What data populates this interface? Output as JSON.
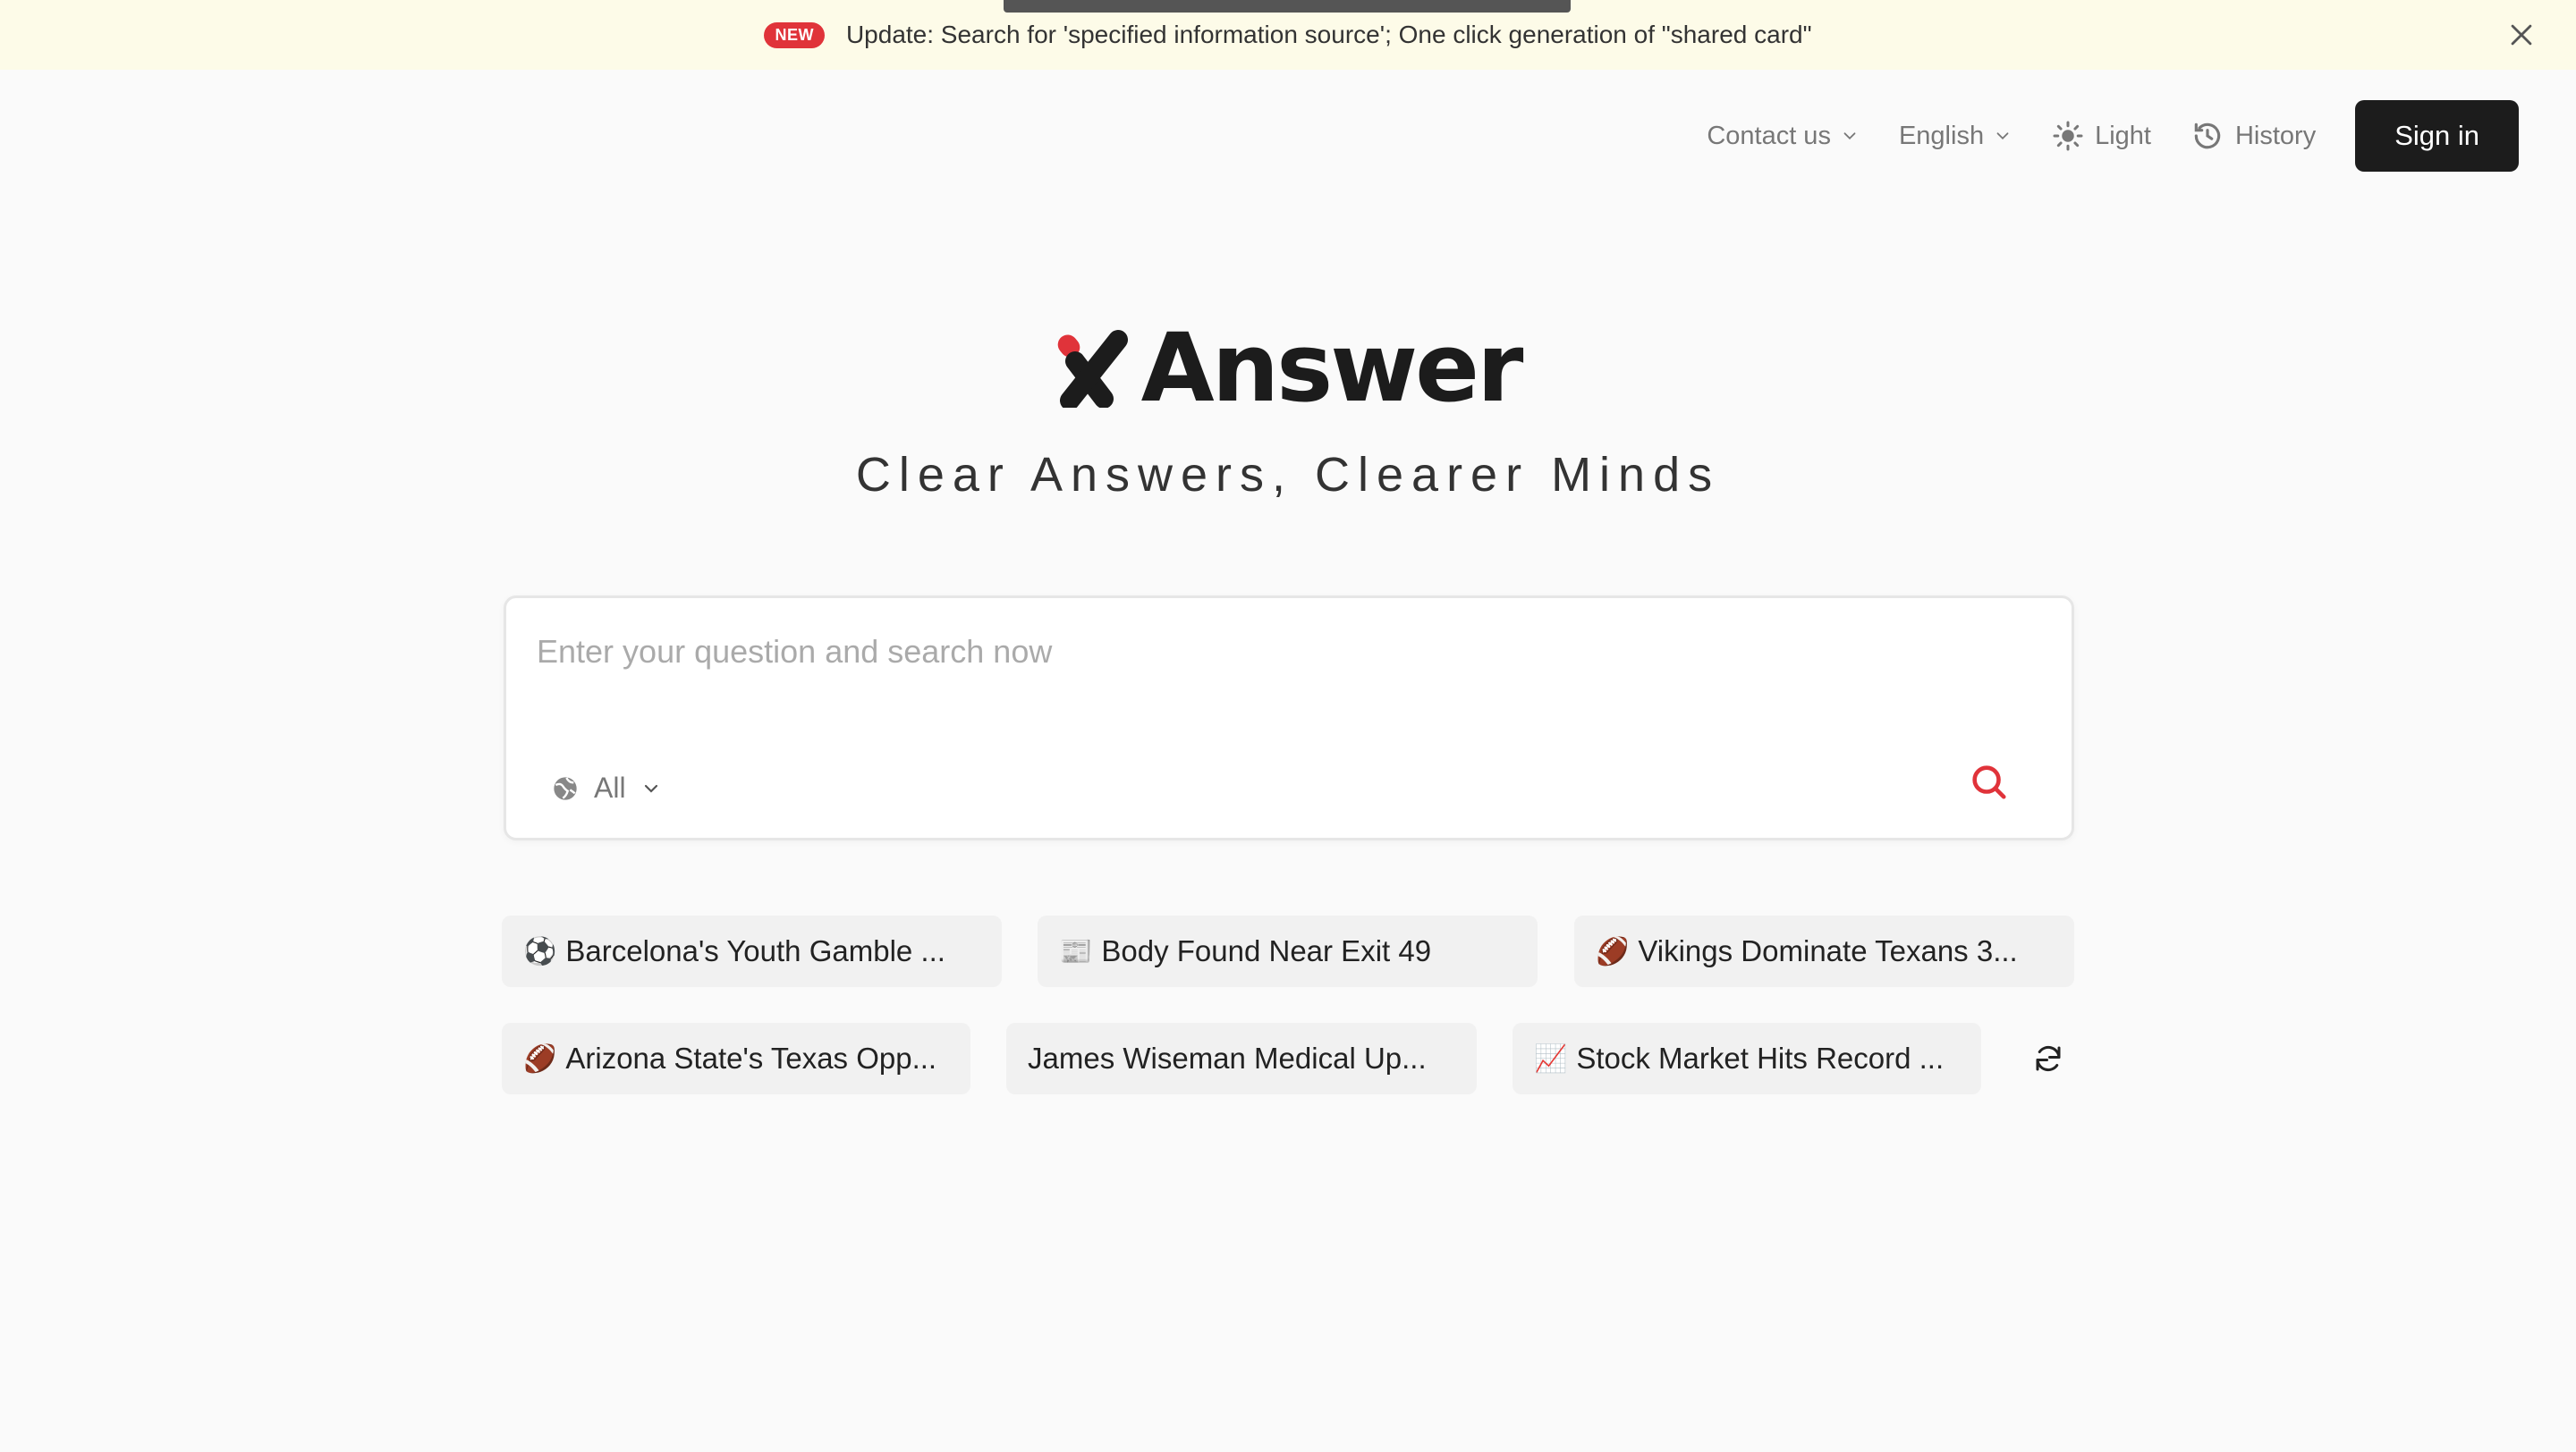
{
  "banner": {
    "badge": "NEW",
    "text": "Update: Search for 'specified information source'; One click generation of \"shared card\""
  },
  "nav": {
    "contact": "Contact us",
    "language": "English",
    "theme": "Light",
    "history": "History",
    "signin": "Sign in"
  },
  "logo": {
    "text": "Answer"
  },
  "tagline": "Clear Answers, Clearer Minds",
  "search": {
    "placeholder": "Enter your question and search now",
    "source": "All"
  },
  "suggestions": [
    {
      "emoji": "⚽",
      "text": "Barcelona's Youth Gamble ..."
    },
    {
      "emoji": "📰",
      "text": "Body Found Near Exit 49"
    },
    {
      "emoji": "🏈",
      "text": "Vikings Dominate Texans 3..."
    },
    {
      "emoji": "🏈",
      "text": "Arizona State's Texas Opp..."
    },
    {
      "emoji": "",
      "text": "James Wiseman Medical Up..."
    },
    {
      "emoji": "📈",
      "text": "Stock Market Hits Record ..."
    }
  ],
  "colors": {
    "accent": "#e0333a",
    "banner_bg": "#fdfbe8",
    "button_dark": "#1c1c1c"
  }
}
